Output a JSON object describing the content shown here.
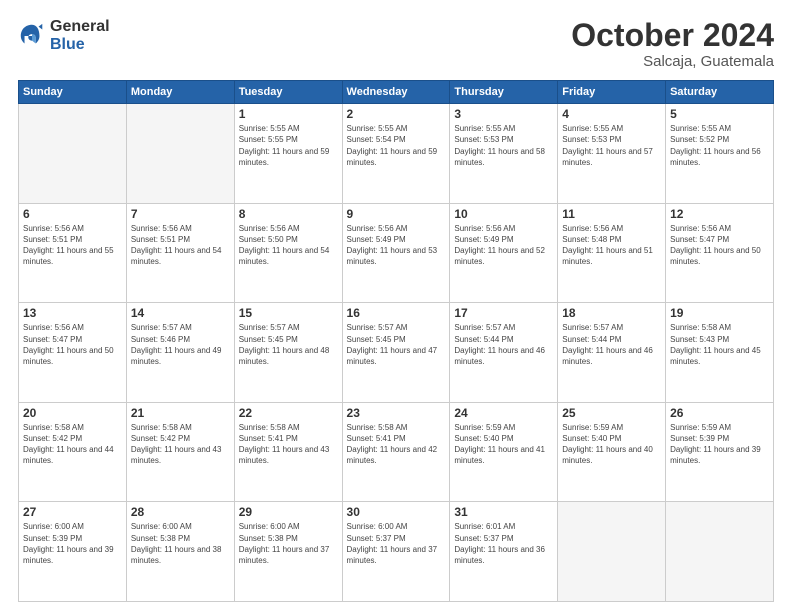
{
  "logo": {
    "general": "General",
    "blue": "Blue"
  },
  "header": {
    "month": "October 2024",
    "location": "Salcaja, Guatemala"
  },
  "weekdays": [
    "Sunday",
    "Monday",
    "Tuesday",
    "Wednesday",
    "Thursday",
    "Friday",
    "Saturday"
  ],
  "weeks": [
    [
      {
        "day": "",
        "empty": true
      },
      {
        "day": "",
        "empty": true
      },
      {
        "day": "1",
        "sunrise": "5:55 AM",
        "sunset": "5:55 PM",
        "daylight": "11 hours and 59 minutes."
      },
      {
        "day": "2",
        "sunrise": "5:55 AM",
        "sunset": "5:54 PM",
        "daylight": "11 hours and 59 minutes."
      },
      {
        "day": "3",
        "sunrise": "5:55 AM",
        "sunset": "5:53 PM",
        "daylight": "11 hours and 58 minutes."
      },
      {
        "day": "4",
        "sunrise": "5:55 AM",
        "sunset": "5:53 PM",
        "daylight": "11 hours and 57 minutes."
      },
      {
        "day": "5",
        "sunrise": "5:55 AM",
        "sunset": "5:52 PM",
        "daylight": "11 hours and 56 minutes."
      }
    ],
    [
      {
        "day": "6",
        "sunrise": "5:56 AM",
        "sunset": "5:51 PM",
        "daylight": "11 hours and 55 minutes."
      },
      {
        "day": "7",
        "sunrise": "5:56 AM",
        "sunset": "5:51 PM",
        "daylight": "11 hours and 54 minutes."
      },
      {
        "day": "8",
        "sunrise": "5:56 AM",
        "sunset": "5:50 PM",
        "daylight": "11 hours and 54 minutes."
      },
      {
        "day": "9",
        "sunrise": "5:56 AM",
        "sunset": "5:49 PM",
        "daylight": "11 hours and 53 minutes."
      },
      {
        "day": "10",
        "sunrise": "5:56 AM",
        "sunset": "5:49 PM",
        "daylight": "11 hours and 52 minutes."
      },
      {
        "day": "11",
        "sunrise": "5:56 AM",
        "sunset": "5:48 PM",
        "daylight": "11 hours and 51 minutes."
      },
      {
        "day": "12",
        "sunrise": "5:56 AM",
        "sunset": "5:47 PM",
        "daylight": "11 hours and 50 minutes."
      }
    ],
    [
      {
        "day": "13",
        "sunrise": "5:56 AM",
        "sunset": "5:47 PM",
        "daylight": "11 hours and 50 minutes."
      },
      {
        "day": "14",
        "sunrise": "5:57 AM",
        "sunset": "5:46 PM",
        "daylight": "11 hours and 49 minutes."
      },
      {
        "day": "15",
        "sunrise": "5:57 AM",
        "sunset": "5:45 PM",
        "daylight": "11 hours and 48 minutes."
      },
      {
        "day": "16",
        "sunrise": "5:57 AM",
        "sunset": "5:45 PM",
        "daylight": "11 hours and 47 minutes."
      },
      {
        "day": "17",
        "sunrise": "5:57 AM",
        "sunset": "5:44 PM",
        "daylight": "11 hours and 46 minutes."
      },
      {
        "day": "18",
        "sunrise": "5:57 AM",
        "sunset": "5:44 PM",
        "daylight": "11 hours and 46 minutes."
      },
      {
        "day": "19",
        "sunrise": "5:58 AM",
        "sunset": "5:43 PM",
        "daylight": "11 hours and 45 minutes."
      }
    ],
    [
      {
        "day": "20",
        "sunrise": "5:58 AM",
        "sunset": "5:42 PM",
        "daylight": "11 hours and 44 minutes."
      },
      {
        "day": "21",
        "sunrise": "5:58 AM",
        "sunset": "5:42 PM",
        "daylight": "11 hours and 43 minutes."
      },
      {
        "day": "22",
        "sunrise": "5:58 AM",
        "sunset": "5:41 PM",
        "daylight": "11 hours and 43 minutes."
      },
      {
        "day": "23",
        "sunrise": "5:58 AM",
        "sunset": "5:41 PM",
        "daylight": "11 hours and 42 minutes."
      },
      {
        "day": "24",
        "sunrise": "5:59 AM",
        "sunset": "5:40 PM",
        "daylight": "11 hours and 41 minutes."
      },
      {
        "day": "25",
        "sunrise": "5:59 AM",
        "sunset": "5:40 PM",
        "daylight": "11 hours and 40 minutes."
      },
      {
        "day": "26",
        "sunrise": "5:59 AM",
        "sunset": "5:39 PM",
        "daylight": "11 hours and 39 minutes."
      }
    ],
    [
      {
        "day": "27",
        "sunrise": "6:00 AM",
        "sunset": "5:39 PM",
        "daylight": "11 hours and 39 minutes."
      },
      {
        "day": "28",
        "sunrise": "6:00 AM",
        "sunset": "5:38 PM",
        "daylight": "11 hours and 38 minutes."
      },
      {
        "day": "29",
        "sunrise": "6:00 AM",
        "sunset": "5:38 PM",
        "daylight": "11 hours and 37 minutes."
      },
      {
        "day": "30",
        "sunrise": "6:00 AM",
        "sunset": "5:37 PM",
        "daylight": "11 hours and 37 minutes."
      },
      {
        "day": "31",
        "sunrise": "6:01 AM",
        "sunset": "5:37 PM",
        "daylight": "11 hours and 36 minutes."
      },
      {
        "day": "",
        "empty": true
      },
      {
        "day": "",
        "empty": true
      }
    ]
  ]
}
